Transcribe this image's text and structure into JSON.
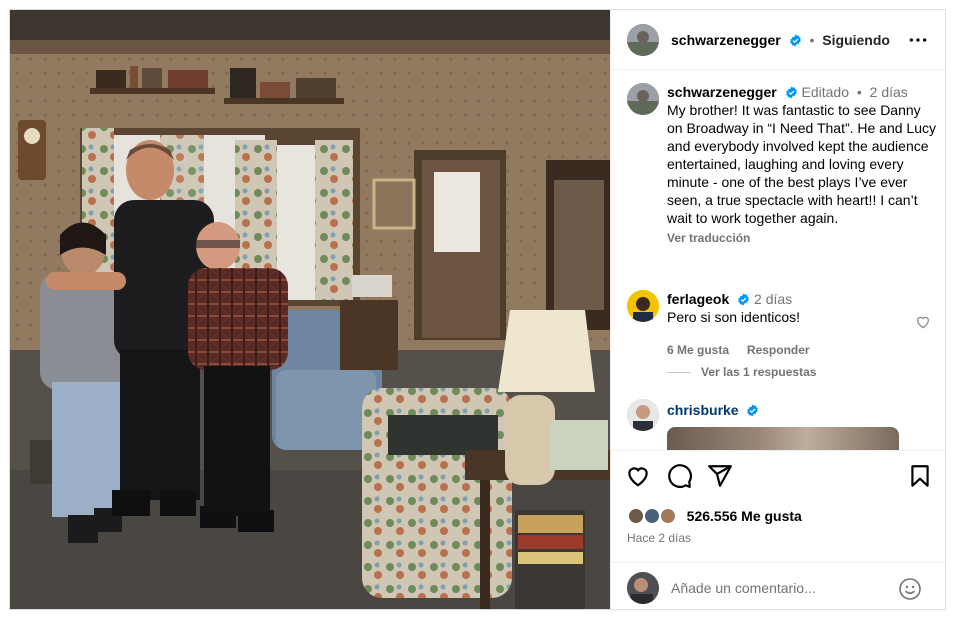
{
  "post": {
    "author": "schwarzenegger",
    "follow_status": "Siguiendo",
    "caption": {
      "author": "schwarzenegger",
      "edited": "Editado",
      "age": "2 días",
      "text": "My brother! It was fantastic to see Danny on Broadway in “I Need That”. He and Lucy and everybody involved kept the audience entertained, laughing and loving every minute - one of the best plays I’ve ever seen, a true spectacle with heart!! I can’t wait to work together again.",
      "translate": "Ver traducción"
    },
    "comments": [
      {
        "author": "ferlageok",
        "age": "2 días",
        "text": "Pero si son identicos!",
        "likes": "6 Me gusta",
        "reply": "Responder",
        "view_replies": "Ver las 1 respuestas"
      },
      {
        "author": "chrisburke"
      }
    ],
    "likes": "526.556 Me gusta",
    "posted": "Hace 2 días",
    "add_comment_placeholder": "Añade un comentario..."
  },
  "icons": [
    "more-options-icon",
    "verified-badge-icon",
    "heart-icon",
    "comment-icon",
    "share-icon",
    "save-bookmark-icon",
    "emoji-icon"
  ],
  "colors": {
    "verified": "#0095f6",
    "muted": "#737373",
    "border": "#dbdbdb"
  }
}
